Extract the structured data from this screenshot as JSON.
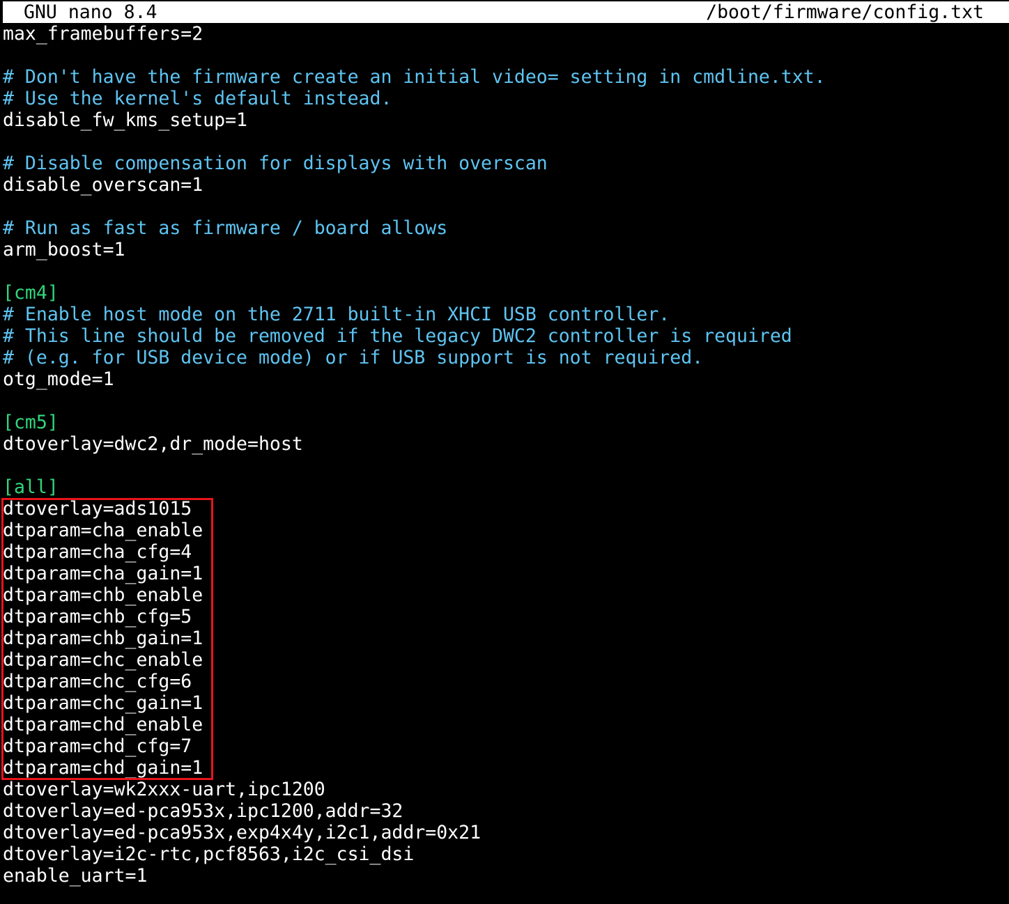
{
  "titlebar": {
    "app": "GNU nano 8.4",
    "file": "/boot/firmware/config.txt"
  },
  "colors": {
    "comment": "#5ec4f2",
    "section": "#31d67a",
    "text": "#ffffff",
    "background": "#000000",
    "highlight_border": "#e8141a"
  },
  "lines": [
    {
      "text": "max_framebuffers=2",
      "kind": "plain"
    },
    {
      "text": "",
      "kind": "plain"
    },
    {
      "text": "# Don't have the firmware create an initial video= setting in cmdline.txt.",
      "kind": "comment"
    },
    {
      "text": "# Use the kernel's default instead.",
      "kind": "comment"
    },
    {
      "text": "disable_fw_kms_setup=1",
      "kind": "plain"
    },
    {
      "text": "",
      "kind": "plain"
    },
    {
      "text": "# Disable compensation for displays with overscan",
      "kind": "comment"
    },
    {
      "text": "disable_overscan=1",
      "kind": "plain"
    },
    {
      "text": "",
      "kind": "plain"
    },
    {
      "text": "# Run as fast as firmware / board allows",
      "kind": "comment"
    },
    {
      "text": "arm_boost=1",
      "kind": "plain"
    },
    {
      "text": "",
      "kind": "plain"
    },
    {
      "text": "[cm4]",
      "kind": "section"
    },
    {
      "text": "# Enable host mode on the 2711 built-in XHCI USB controller.",
      "kind": "comment"
    },
    {
      "text": "# This line should be removed if the legacy DWC2 controller is required",
      "kind": "comment"
    },
    {
      "text": "# (e.g. for USB device mode) or if USB support is not required.",
      "kind": "comment"
    },
    {
      "text": "otg_mode=1",
      "kind": "plain"
    },
    {
      "text": "",
      "kind": "plain"
    },
    {
      "text": "[cm5]",
      "kind": "section"
    },
    {
      "text": "dtoverlay=dwc2,dr_mode=host",
      "kind": "plain"
    },
    {
      "text": "",
      "kind": "plain"
    },
    {
      "text": "[all]",
      "kind": "section"
    },
    {
      "text": "dtoverlay=ads1015",
      "kind": "plain"
    },
    {
      "text": "dtparam=cha_enable",
      "kind": "plain"
    },
    {
      "text": "dtparam=cha_cfg=4",
      "kind": "plain"
    },
    {
      "text": "dtparam=cha_gain=1",
      "kind": "plain"
    },
    {
      "text": "dtparam=chb_enable",
      "kind": "plain"
    },
    {
      "text": "dtparam=chb_cfg=5",
      "kind": "plain"
    },
    {
      "text": "dtparam=chb_gain=1",
      "kind": "plain"
    },
    {
      "text": "dtparam=chc_enable",
      "kind": "plain"
    },
    {
      "text": "dtparam=chc_cfg=6",
      "kind": "plain"
    },
    {
      "text": "dtparam=chc_gain=1",
      "kind": "plain"
    },
    {
      "text": "dtparam=chd_enable",
      "kind": "plain"
    },
    {
      "text": "dtparam=chd_cfg=7",
      "kind": "plain"
    },
    {
      "text": "dtparam=chd_gain=1",
      "kind": "plain"
    },
    {
      "text": "dtoverlay=wk2xxx-uart,ipc1200",
      "kind": "plain"
    },
    {
      "text": "dtoverlay=ed-pca953x,ipc1200,addr=32",
      "kind": "plain"
    },
    {
      "text": "dtoverlay=ed-pca953x,exp4x4y,i2c1,addr=0x21",
      "kind": "plain"
    },
    {
      "text": "dtoverlay=i2c-rtc,pcf8563,i2c_csi_dsi",
      "kind": "plain"
    },
    {
      "text": "enable_uart=1",
      "kind": "plain"
    }
  ]
}
